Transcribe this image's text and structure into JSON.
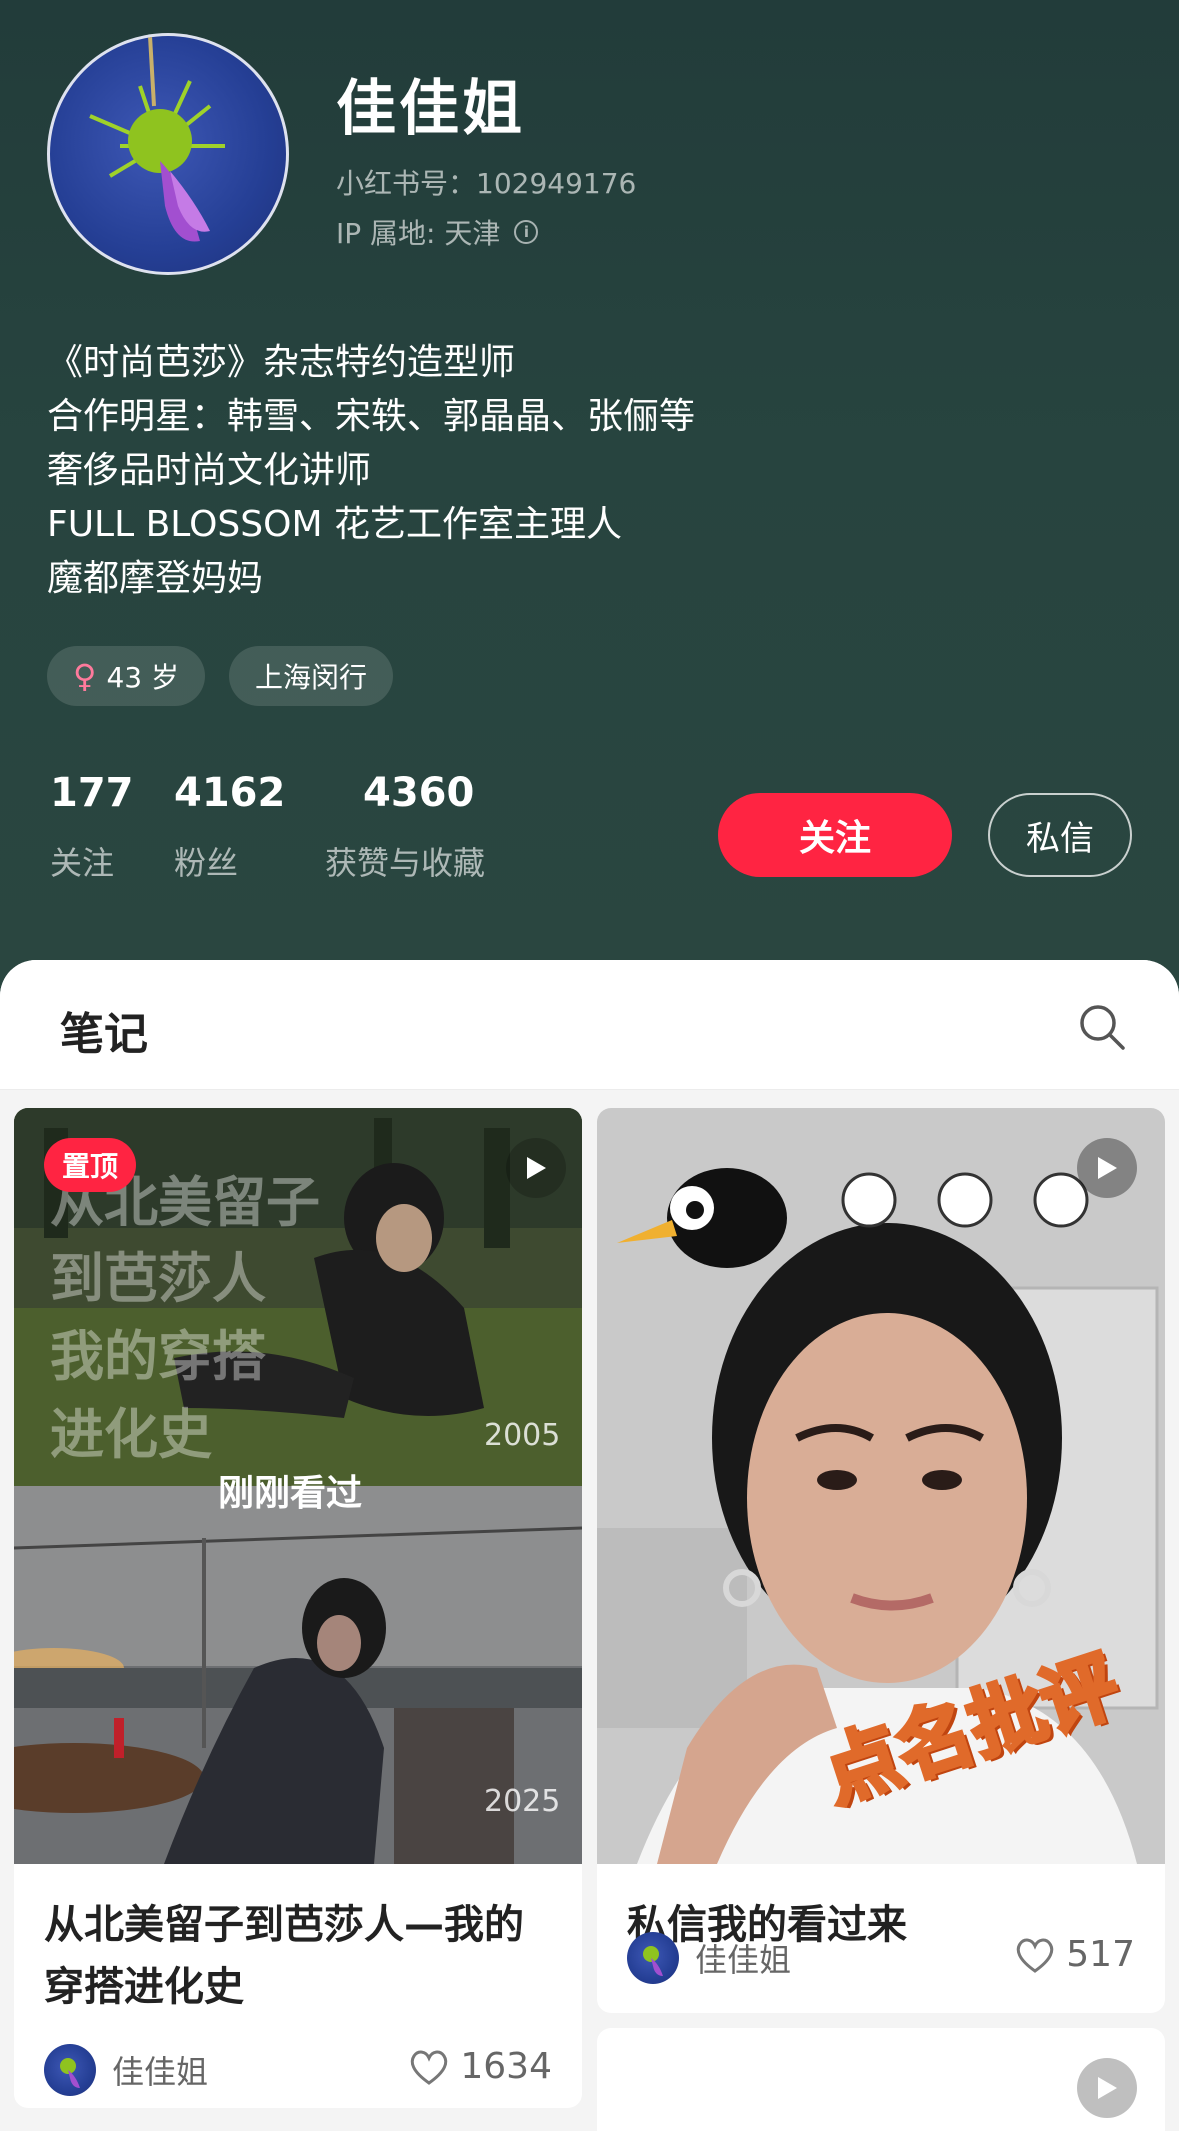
{
  "profile": {
    "nickname": "佳佳姐",
    "red_id": "小红书号：102949176",
    "ip_location": "IP 属地: 天津",
    "bio": [
      "《时尚芭莎》杂志特约造型师",
      "合作明星：韩雪、宋轶、郭晶晶、张俪等",
      "奢侈品时尚文化讲师",
      "FULL BLOSSOM 花艺工作室主理人",
      "魔都摩登妈妈"
    ],
    "tags": {
      "age": "43 岁",
      "location": "上海闵行"
    },
    "stats": [
      {
        "num": "177",
        "label": "关注"
      },
      {
        "num": "4162",
        "label": "粉丝"
      },
      {
        "num": "4360",
        "label": "获赞与收藏"
      }
    ],
    "follow_label": "关注",
    "message_label": "私信"
  },
  "notes": {
    "title": "笔记",
    "cards": [
      {
        "pinned_label": "置顶",
        "cover_text": [
          "从北美留子",
          "到芭莎人",
          "我的穿搭",
          "进化史"
        ],
        "year_top": "2005",
        "year_bottom": "2025",
        "seen_label": "刚刚看过",
        "title": "从北美留子到芭莎人—我的穿搭进化史",
        "author": "佳佳姐",
        "likes": "1634"
      },
      {
        "cover_caption": "点名批评",
        "title": "私信我的看过来",
        "author": "佳佳姐",
        "likes": "517"
      }
    ]
  },
  "colors": {
    "accent": "#ff2442",
    "header_bg": "#27443f"
  },
  "icons": [
    "info-icon",
    "female-icon",
    "search-icon",
    "play-icon",
    "heart-icon"
  ]
}
